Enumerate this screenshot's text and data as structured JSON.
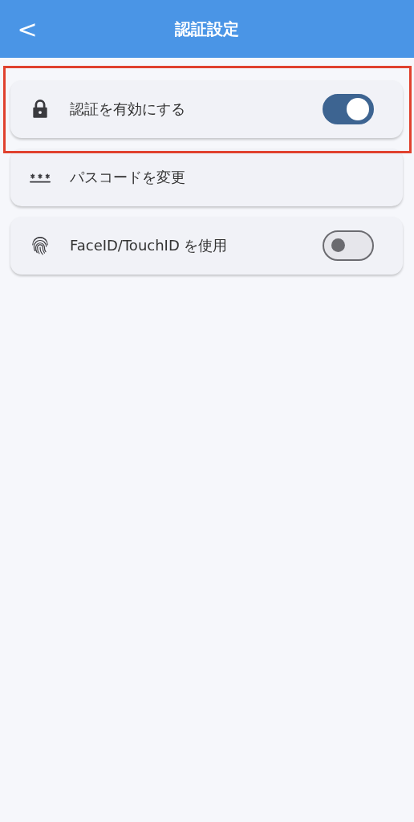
{
  "header": {
    "back": "<",
    "title": "認証設定"
  },
  "settings": [
    {
      "kind": "toggle",
      "label": "認証を有効にする",
      "on": true,
      "highlighted": true
    },
    {
      "kind": "link",
      "label": "パスコードを変更",
      "highlighted": false
    },
    {
      "kind": "toggle",
      "label": "FaceID/TouchID を使用",
      "on": false,
      "highlighted": false
    }
  ]
}
